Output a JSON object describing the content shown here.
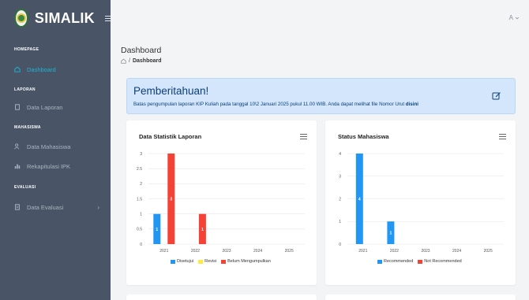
{
  "brand": {
    "name": "SIMALIK"
  },
  "sidebar": {
    "sections": [
      {
        "title": "HOMEPAGE",
        "items": [
          {
            "label": "Dashboard",
            "icon": "home-icon",
            "active": true
          }
        ]
      },
      {
        "title": "LAPORAN",
        "items": [
          {
            "label": "Data Laporan",
            "icon": "document-icon"
          }
        ]
      },
      {
        "title": "MAHASISWA",
        "items": [
          {
            "label": "Data Mahasiswa",
            "icon": "users-icon"
          },
          {
            "label": "Rekapitulasi IPK",
            "icon": "bar-chart-icon"
          }
        ]
      },
      {
        "title": "EVALUASI",
        "items": [
          {
            "label": "Data Evaluasi",
            "icon": "file-icon",
            "chevron": "›"
          }
        ]
      }
    ]
  },
  "header": {
    "user_menu": "A",
    "user_menu_icon": "chevron-down-icon"
  },
  "page": {
    "title": "Dashboard",
    "breadcrumb_sep": "/",
    "breadcrumb_current": "Dashboard"
  },
  "alert": {
    "title": "Pemberitahuan!",
    "text": "Batas pengumpulan laporan KIP Kuliah pada tanggal 10\\2 Januari 2025 pukul 11.00 WIB. Anda dapat melihat file Nomor Urut ",
    "link": "disini",
    "edit_icon": "edit-icon"
  },
  "colors": {
    "blue": "#2196f3",
    "yellow": "#ffeb3b",
    "red": "#f44336",
    "accent": "#19b5d6"
  },
  "charts": {
    "laporan": {
      "title": "Data Statistik Laporan",
      "menu_icon": "menu-icon"
    },
    "mahasiswa": {
      "title": "Status Mahasiswa",
      "menu_icon": "menu-icon"
    }
  },
  "chart_data": [
    {
      "type": "bar",
      "title": "Data Statistik Laporan",
      "categories": [
        "2021",
        "2022",
        "2023",
        "2024",
        "2025"
      ],
      "ylim": [
        0,
        3
      ],
      "yticks": [
        "0",
        "0.5",
        "1",
        "1.5",
        "2",
        "2.5",
        "3"
      ],
      "series": [
        {
          "name": "Disetujui",
          "color": "#2196f3",
          "values": [
            1,
            0,
            0,
            0,
            0
          ]
        },
        {
          "name": "Revisi",
          "color": "#ffeb3b",
          "values": [
            0,
            0,
            0,
            0,
            0
          ]
        },
        {
          "name": "Belum Mengumpulkan",
          "color": "#f44336",
          "values": [
            3,
            1,
            0,
            0,
            0
          ]
        }
      ],
      "grid": true,
      "legend": "bottom"
    },
    {
      "type": "bar",
      "title": "Status Mahasiswa",
      "categories": [
        "2021",
        "2022",
        "2023",
        "2024",
        "2025"
      ],
      "ylim": [
        0,
        4
      ],
      "yticks": [
        "0",
        "1",
        "2",
        "3",
        "4"
      ],
      "series": [
        {
          "name": "Recommended",
          "color": "#2196f3",
          "values": [
            4,
            1,
            0,
            0,
            0
          ]
        },
        {
          "name": "Not Recommended",
          "color": "#f44336",
          "values": [
            0,
            0,
            0,
            0,
            0
          ]
        }
      ],
      "grid": true,
      "legend": "bottom"
    }
  ]
}
